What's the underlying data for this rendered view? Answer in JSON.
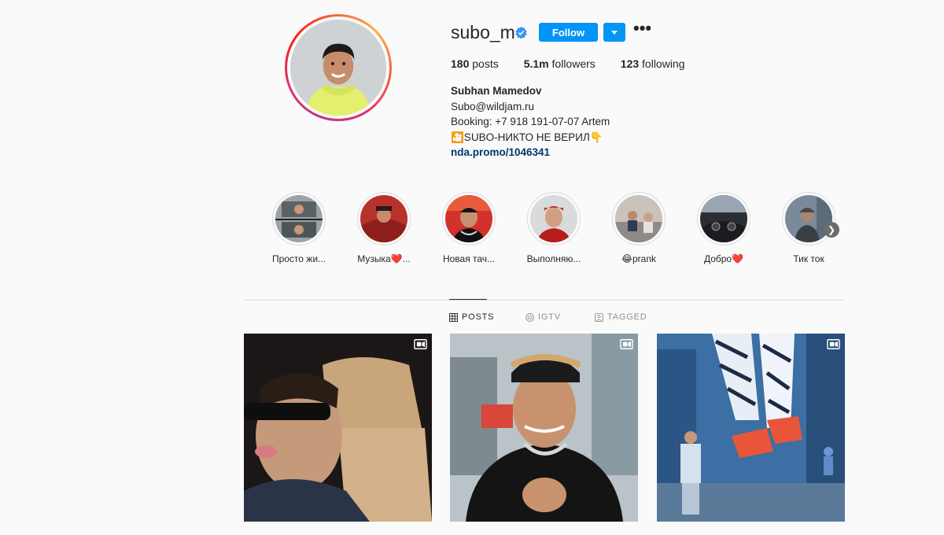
{
  "profile": {
    "username": "subo_m",
    "follow_label": "Follow",
    "more_label": "•••",
    "stats": [
      {
        "value": "180",
        "label": "posts"
      },
      {
        "value": "5.1m",
        "label": "followers"
      },
      {
        "value": "123",
        "label": "following"
      }
    ],
    "bio": {
      "name": "Subhan Mamedov",
      "line1": "Subo@wildjam.ru",
      "line2": "Booking: +7 918 191-07-07 Artem",
      "line3": "🎦SUBO-НИКТО НЕ ВЕРИЛ👇",
      "link": "nda.promo/1046341"
    }
  },
  "highlights": [
    {
      "label": "Просто жи..."
    },
    {
      "label": "Музыка❤️..."
    },
    {
      "label": "Новая тач..."
    },
    {
      "label": "Выполняю..."
    },
    {
      "label": "😂prank"
    },
    {
      "label": "Добро❤️"
    },
    {
      "label": "Тик ток"
    }
  ],
  "tabs": [
    {
      "label": "POSTS",
      "icon": "grid-icon",
      "active": true
    },
    {
      "label": "IGTV",
      "icon": "igtv-icon",
      "active": false
    },
    {
      "label": "TAGGED",
      "icon": "tagged-icon",
      "active": false
    }
  ],
  "posts": [
    {
      "type": "video",
      "icon": "video-icon"
    },
    {
      "type": "video",
      "icon": "video-icon"
    },
    {
      "type": "video",
      "icon": "video-icon"
    }
  ],
  "colors": {
    "accent": "#0095f6",
    "link": "#00376b",
    "text": "#262626",
    "muted": "#8e8e8e",
    "border": "#dbdbdb"
  }
}
